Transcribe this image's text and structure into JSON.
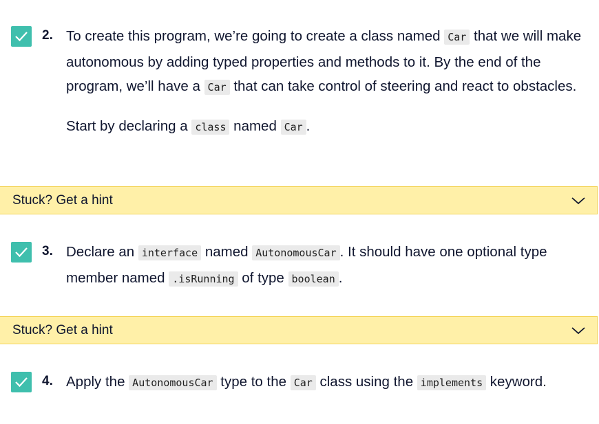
{
  "colors": {
    "checkbox": "#3fbfad",
    "hint_bg": "#fff0a8",
    "hint_border": "#f4d45a",
    "text": "#10162f"
  },
  "tasks": [
    {
      "number": "2.",
      "checked": true,
      "p1": {
        "t1": "To create this program, we’re going to create a class named ",
        "c1": "Car",
        "t2": " that we will make autonomous by adding typed properties and methods to it. By the end of the program, we’ll have a ",
        "c2": "Car",
        "t3": " that can take control of steering and react to obstacles."
      },
      "p2": {
        "t1": "Start by declaring a ",
        "c1": "class",
        "t2": " named ",
        "c2": "Car",
        "t3": "."
      }
    },
    {
      "number": "3.",
      "checked": true,
      "p1": {
        "t1": "Declare an ",
        "c1": "interface",
        "t2": " named ",
        "c2": "AutonomousCar",
        "t3": ". It should have one optional type member named ",
        "c3": ".isRunning",
        "t4": " of type ",
        "c4": "boolean",
        "t5": "."
      }
    },
    {
      "number": "4.",
      "checked": true,
      "p1": {
        "t1": "Apply the ",
        "c1": "AutonomousCar",
        "t2": " type to the ",
        "c2": "Car",
        "t3": " class using the ",
        "c3": "implements",
        "t4": " keyword."
      }
    }
  ],
  "hints": [
    {
      "label": "Stuck? Get a hint",
      "icon": "chevron-down-icon"
    },
    {
      "label": "Stuck? Get a hint",
      "icon": "chevron-down-icon"
    }
  ]
}
